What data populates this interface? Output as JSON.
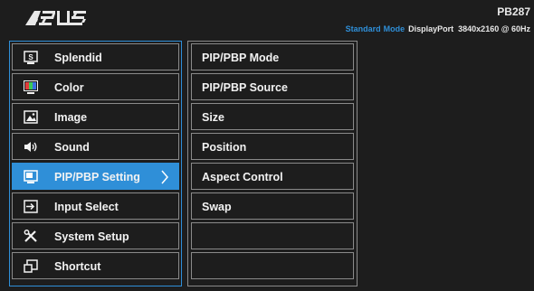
{
  "header": {
    "model": "PB287",
    "mode_label": "Standard",
    "mode_value": "Mode",
    "port": "DisplayPort",
    "resolution": "3840x2160 @ 60Hz"
  },
  "menu": {
    "items": [
      {
        "label": "Splendid",
        "icon": "splendid-icon"
      },
      {
        "label": "Color",
        "icon": "color-icon"
      },
      {
        "label": "Image",
        "icon": "image-icon"
      },
      {
        "label": "Sound",
        "icon": "speaker-icon"
      },
      {
        "label": "PIP/PBP Setting",
        "icon": "pip-icon",
        "active": true
      },
      {
        "label": "Input Select",
        "icon": "input-icon"
      },
      {
        "label": "System Setup",
        "icon": "tools-icon"
      },
      {
        "label": "Shortcut",
        "icon": "shortcut-icon"
      }
    ]
  },
  "submenu": {
    "items": [
      "PIP/PBP Mode",
      "PIP/PBP Source",
      "Size",
      "Position",
      "Aspect Control",
      "Swap",
      "",
      ""
    ]
  },
  "colors": {
    "accent": "#2f8fd8",
    "background": "#1d1d1d",
    "border": "#8a8a8a",
    "text": "#f2f2f2"
  }
}
